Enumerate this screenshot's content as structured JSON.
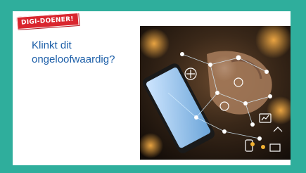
{
  "badge": {
    "label": "DIGI-DOENER!"
  },
  "headline": {
    "line1": "Klinkt dit",
    "line2": "ongeloofwaardig?"
  },
  "photo": {
    "subject": "hand-holding-smartphone-with-digital-network-icons"
  },
  "colors": {
    "page_background": "#2fae9c",
    "card": "#ffffff",
    "badge": "#d9262e",
    "headline": "#1d5fa8"
  }
}
